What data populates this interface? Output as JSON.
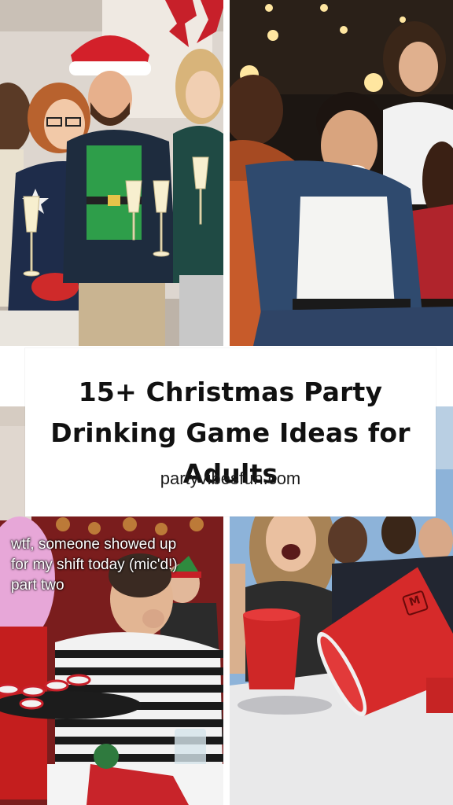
{
  "title_card": {
    "headline": "15+  Christmas Party Drinking Game Ideas for Adults",
    "website": "partyvibesfun.com"
  },
  "photos": {
    "top_left": "office-christmas-party-photo",
    "top_right": "laughing-friends-party-photo",
    "bottom_left": {
      "caption": "wtf, someone showed up\nfor my shift today (mic'd!)\npart two"
    },
    "bottom_right": "beer-pong-cups-photo"
  },
  "colors": {
    "title_bg": "#ffffff",
    "title_text": "#111111",
    "cup_red": "#d62a2a"
  }
}
